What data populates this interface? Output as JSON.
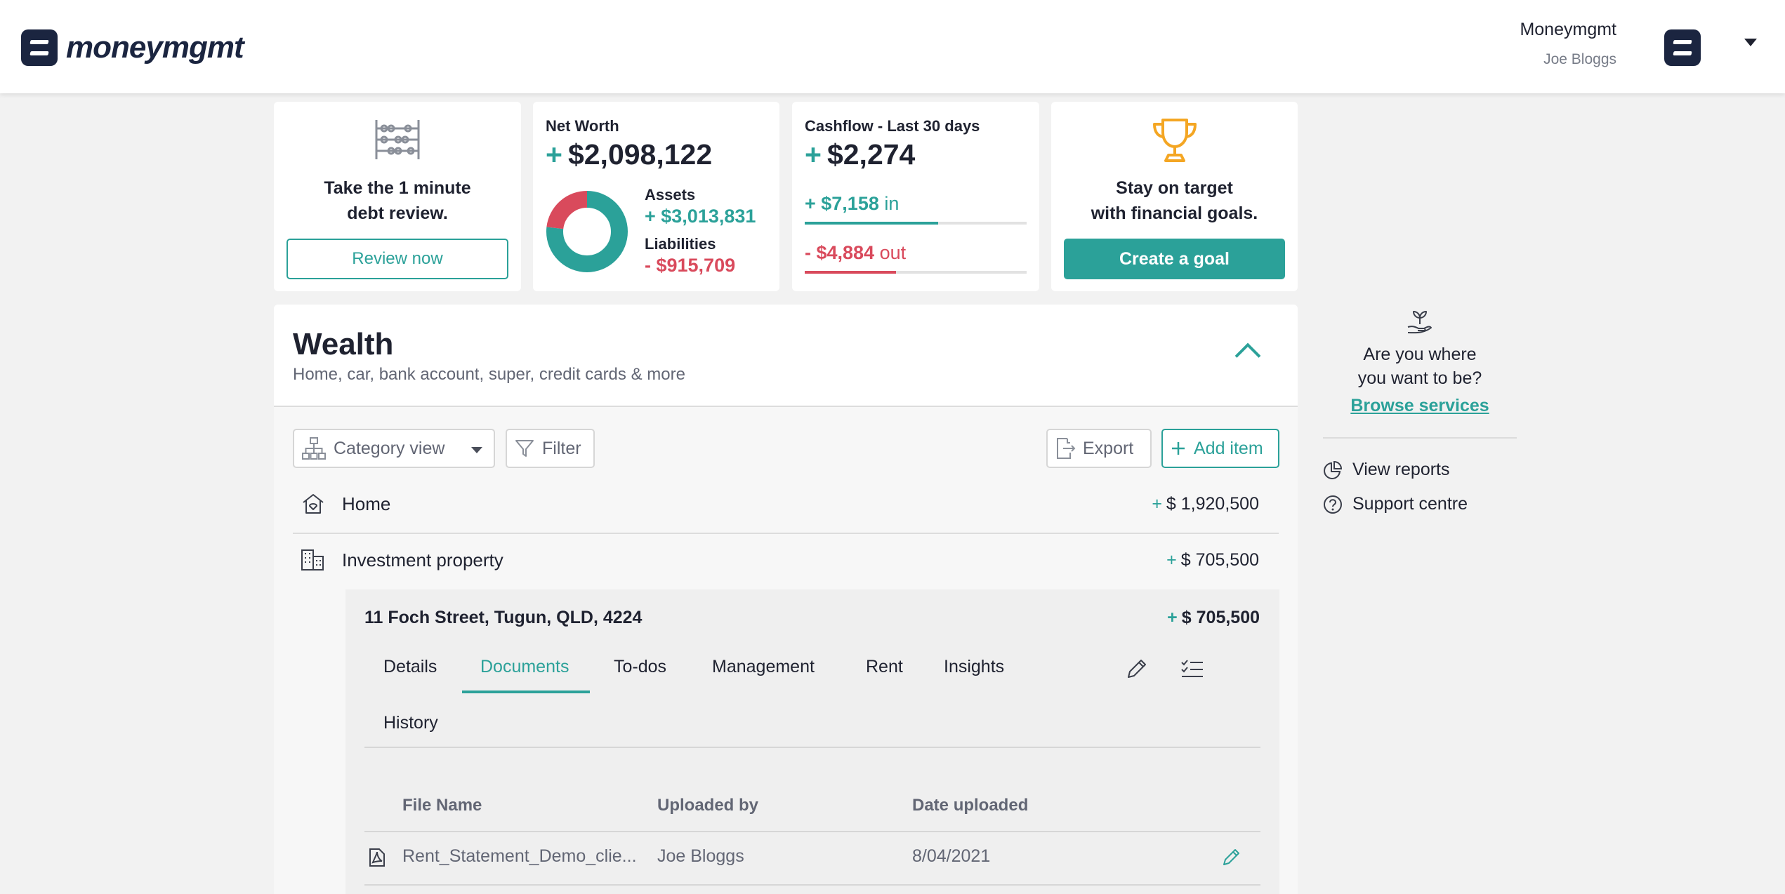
{
  "header": {
    "brand": "moneymgmt",
    "org_name": "Moneymgmt",
    "user_name": "Joe Bloggs"
  },
  "cards": {
    "debt": {
      "line1": "Take the 1 minute",
      "line2": "debt review.",
      "button": "Review now",
      "icon": "abacus-icon"
    },
    "net_worth": {
      "label": "Net Worth",
      "sign": "+",
      "value": "$2,098,122",
      "assets_label": "Assets",
      "assets_value": "+ $3,013,831",
      "liabilities_label": "Liabilities",
      "liabilities_value": "- $915,709",
      "assets_fraction": 0.767
    },
    "cashflow": {
      "label": "Cashflow - Last 30 days",
      "sign": "+",
      "value": "$2,274",
      "in_value": "+ $7,158",
      "in_suffix": "in",
      "out_value": "- $4,884",
      "out_suffix": "out",
      "in_fraction": 0.6,
      "out_fraction": 0.41
    },
    "goal": {
      "line1": "Stay on target",
      "line2": "with financial goals.",
      "button": "Create a goal",
      "icon": "trophy-icon"
    }
  },
  "wealth": {
    "title": "Wealth",
    "subtitle": "Home, car, bank account, super, credit cards & more",
    "toolbar": {
      "category_view": "Category view",
      "filter": "Filter",
      "export": "Export",
      "add_item": "Add item"
    },
    "rows": [
      {
        "label": "Home",
        "sign": "+",
        "value": "$ 1,920,500"
      },
      {
        "label": "Investment property",
        "sign": "+",
        "value": "$ 705,500"
      }
    ],
    "property": {
      "address": "11 Foch Street, Tugun, QLD, 4224",
      "sign": "+",
      "value": "$ 705,500",
      "tabs": [
        "Details",
        "Documents",
        "To-dos",
        "Management",
        "Rent",
        "Insights",
        "History"
      ],
      "active_tab": "Documents",
      "table": {
        "headers": [
          "File Name",
          "Uploaded by",
          "Date uploaded"
        ],
        "rows": [
          {
            "file": "Rent_Statement_Demo_clie...",
            "by": "Joe Bloggs",
            "date": "8/04/2021"
          }
        ]
      }
    }
  },
  "sidebar": {
    "question_line1": "Are you where",
    "question_line2": "you want to be?",
    "browse": "Browse services",
    "reports": "View reports",
    "support": "Support centre"
  },
  "colors": {
    "accent": "#2ba199",
    "negative": "#d94a5c",
    "brand": "#1b2540",
    "goal_icon": "#f4a623"
  }
}
